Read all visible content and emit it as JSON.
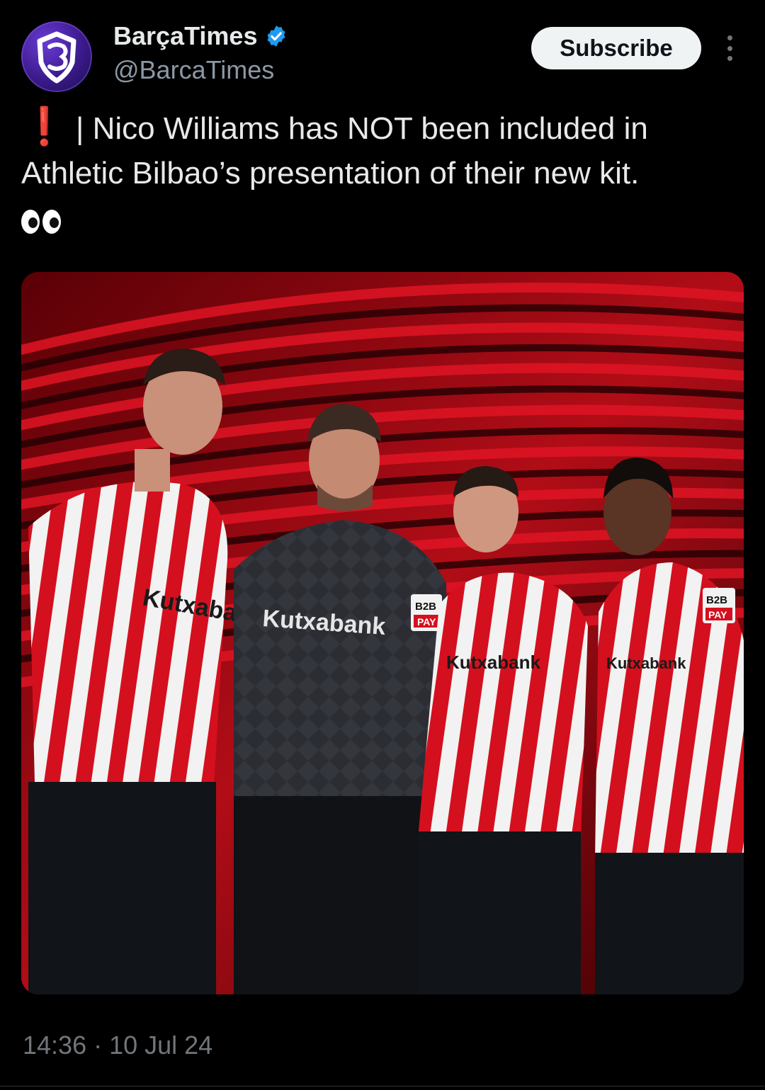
{
  "tweet": {
    "display_name": "BarçaTimes",
    "handle": "@BarcaTimes",
    "subscribe_label": "Subscribe",
    "text_prefix": "❗",
    "text": " | Nico Williams has NOT been included in Athletic Bilbao’s presentation of their new kit.",
    "timestamp": "14:36 · 10 Jul 24"
  },
  "icons": {
    "avatar": "barcatimes-logo",
    "verified": "verified-badge-icon",
    "more": "more-options-icon",
    "eyes": "eyes-emoji"
  },
  "media": {
    "shirt_sponsor": "Kutxabank",
    "sleeve_badge": [
      "B2B",
      "PAY"
    ]
  },
  "colors": {
    "background": "#000000",
    "verified": "#1d9bf0",
    "stripe_red": "#d4101e",
    "stripe_white": "#f2f2f2",
    "keeper_kit": "#2b2d33"
  }
}
